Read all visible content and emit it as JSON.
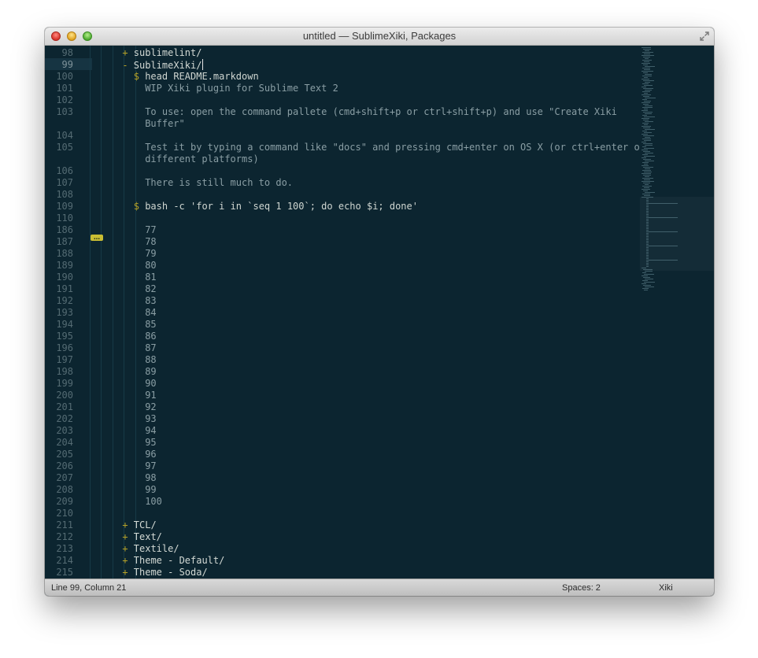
{
  "window": {
    "title": "untitled — SublimeXiki, Packages"
  },
  "status": {
    "position": "Line 99, Column 21",
    "spaces": "Spaces: 2",
    "syntax": "Xiki"
  },
  "lines": [
    {
      "n": "98",
      "indent": 6,
      "text": "sublimelint/",
      "kind": "plus"
    },
    {
      "n": "99",
      "indent": 6,
      "text": "SublimeXiki/",
      "kind": "minus",
      "current": true
    },
    {
      "n": "100",
      "indent": 8,
      "text": "head README.markdown",
      "kind": "dollar"
    },
    {
      "n": "101",
      "indent": 10,
      "text": "WIP Xiki plugin for Sublime Text 2",
      "kind": "out"
    },
    {
      "n": "102",
      "indent": 10,
      "text": "",
      "kind": "out"
    },
    {
      "n": "103",
      "indent": 10,
      "text": "To use: open the command pallete (cmd+shift+p or ctrl+shift+p) and use \"Create Xiki",
      "kind": "out"
    },
    {
      "n": "",
      "indent": 10,
      "text": "Buffer\"",
      "kind": "out"
    },
    {
      "n": "104",
      "indent": 10,
      "text": "",
      "kind": "out"
    },
    {
      "n": "105",
      "indent": 10,
      "text": "Test it by typing a command like \"docs\" and pressing cmd+enter on OS X (or ctrl+enter on",
      "kind": "out"
    },
    {
      "n": "",
      "indent": 10,
      "text": "different platforms)",
      "kind": "out"
    },
    {
      "n": "106",
      "indent": 10,
      "text": "",
      "kind": "out"
    },
    {
      "n": "107",
      "indent": 10,
      "text": "There is still much to do.",
      "kind": "out"
    },
    {
      "n": "108",
      "indent": 10,
      "text": "",
      "kind": "out"
    },
    {
      "n": "109",
      "indent": 8,
      "text": "bash -c 'for i in `seq 1 100`; do echo $i; done'",
      "kind": "dollar"
    },
    {
      "n": "110",
      "indent": 10,
      "text": "",
      "kind": "out"
    },
    {
      "n": "186",
      "indent": 10,
      "text": "77",
      "kind": "out"
    },
    {
      "n": "187",
      "indent": 10,
      "text": "78",
      "kind": "out"
    },
    {
      "n": "188",
      "indent": 10,
      "text": "79",
      "kind": "out"
    },
    {
      "n": "189",
      "indent": 10,
      "text": "80",
      "kind": "out"
    },
    {
      "n": "190",
      "indent": 10,
      "text": "81",
      "kind": "out"
    },
    {
      "n": "191",
      "indent": 10,
      "text": "82",
      "kind": "out"
    },
    {
      "n": "192",
      "indent": 10,
      "text": "83",
      "kind": "out"
    },
    {
      "n": "193",
      "indent": 10,
      "text": "84",
      "kind": "out"
    },
    {
      "n": "194",
      "indent": 10,
      "text": "85",
      "kind": "out"
    },
    {
      "n": "195",
      "indent": 10,
      "text": "86",
      "kind": "out"
    },
    {
      "n": "196",
      "indent": 10,
      "text": "87",
      "kind": "out"
    },
    {
      "n": "197",
      "indent": 10,
      "text": "88",
      "kind": "out"
    },
    {
      "n": "198",
      "indent": 10,
      "text": "89",
      "kind": "out"
    },
    {
      "n": "199",
      "indent": 10,
      "text": "90",
      "kind": "out"
    },
    {
      "n": "200",
      "indent": 10,
      "text": "91",
      "kind": "out"
    },
    {
      "n": "201",
      "indent": 10,
      "text": "92",
      "kind": "out"
    },
    {
      "n": "202",
      "indent": 10,
      "text": "93",
      "kind": "out"
    },
    {
      "n": "203",
      "indent": 10,
      "text": "94",
      "kind": "out"
    },
    {
      "n": "204",
      "indent": 10,
      "text": "95",
      "kind": "out"
    },
    {
      "n": "205",
      "indent": 10,
      "text": "96",
      "kind": "out"
    },
    {
      "n": "206",
      "indent": 10,
      "text": "97",
      "kind": "out"
    },
    {
      "n": "207",
      "indent": 10,
      "text": "98",
      "kind": "out"
    },
    {
      "n": "208",
      "indent": 10,
      "text": "99",
      "kind": "out"
    },
    {
      "n": "209",
      "indent": 10,
      "text": "100",
      "kind": "out"
    },
    {
      "n": "210",
      "indent": 10,
      "text": "",
      "kind": "out"
    },
    {
      "n": "211",
      "indent": 6,
      "text": "TCL/",
      "kind": "plus"
    },
    {
      "n": "212",
      "indent": 6,
      "text": "Text/",
      "kind": "plus"
    },
    {
      "n": "213",
      "indent": 6,
      "text": "Textile/",
      "kind": "plus"
    },
    {
      "n": "214",
      "indent": 6,
      "text": "Theme - Default/",
      "kind": "plus"
    },
    {
      "n": "215",
      "indent": 6,
      "text": "Theme - Soda/",
      "kind": "plus"
    }
  ],
  "fold_marker": "…",
  "colors": {
    "background": "#0c2530",
    "marker": "#b6a126",
    "text": "#95a7ad"
  }
}
